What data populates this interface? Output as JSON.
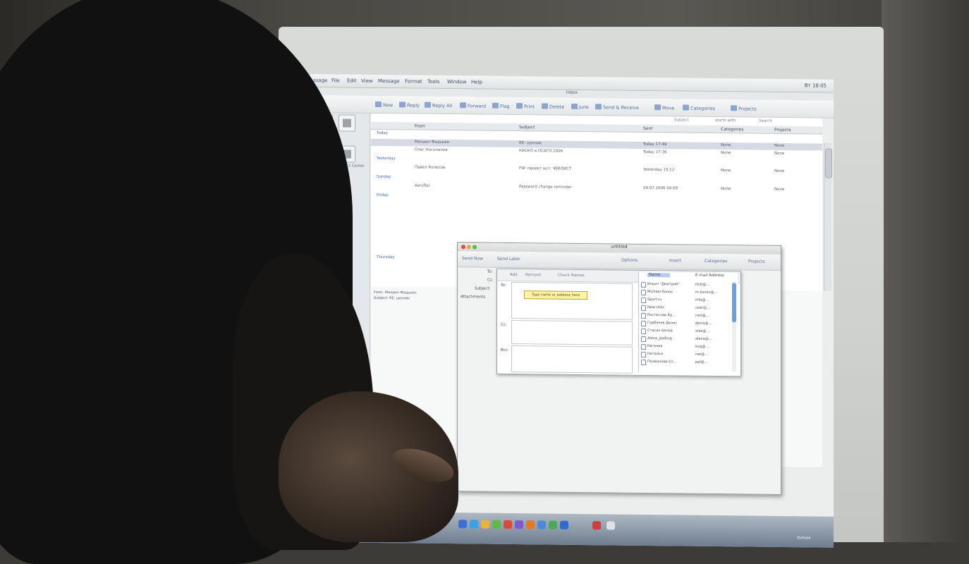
{
  "menubar": {
    "items": [
      "ssage",
      "File",
      "Edit",
      "View",
      "Message",
      "Format",
      "Tools",
      "Window",
      "Help"
    ],
    "clock": "Вт 18:05"
  },
  "window_title": "Inbox",
  "toolbar": {
    "items": [
      "New",
      "Reply",
      "Reply All",
      "Forward",
      "Flag",
      "Print",
      "Delete",
      "Junk",
      "Send & Receive",
      "Move",
      "Categories",
      "Projects"
    ]
  },
  "sidebar": {
    "labels": [
      "Project Center"
    ]
  },
  "list": {
    "columns": [
      "From",
      "Subject",
      "Sent",
      "Categories",
      "Projects"
    ],
    "filter": [
      "Subject",
      "starts with",
      "Search"
    ],
    "groups": {
      "today": "Today",
      "yesterday": "Yesterday",
      "sunday": "Sunday",
      "friday": "Friday",
      "thursday": "Thursday"
    },
    "rows": [
      {
        "from": "Михаил Федькин",
        "subject": "RE: ценник",
        "sent": "Today 17:48",
        "cat": "None",
        "proj": "None"
      },
      {
        "from": "Олег Косолапов",
        "subject": "КАСКО и ОСАГО 2006",
        "sent": "Today 17:36",
        "cat": "None",
        "proj": "None"
      },
      {
        "from": "Павел Колесов",
        "subject": "FW: проект вот: ЧЕКЛИСТ",
        "sent": "Yesterday 15:12",
        "cat": "None",
        "proj": "None"
      },
      {
        "from": "Aeroflot",
        "subject": "Password change reminder",
        "sent": "09.07.2006 04:09",
        "cat": "None",
        "proj": "None"
      }
    ]
  },
  "preview": {
    "lines": [
      "From: Михаил Федькин",
      "Subject: RE: ценник"
    ]
  },
  "compose": {
    "title": "untitled",
    "toolbar": [
      "Send Now",
      "Send Later",
      "Options",
      "Insert",
      "Categories",
      "Projects"
    ],
    "fields": [
      "To:",
      "Cc:",
      "Subject:",
      "Attachments"
    ],
    "picker": {
      "tools": [
        "Add",
        "Remove",
        "Check Names"
      ],
      "to_label": "To:",
      "cc_label": "Cc:",
      "bcc_label": "Bcc:",
      "tooltip": "Type name or address here"
    },
    "contacts": {
      "header_name": "Name",
      "header_email": "E-mail Address",
      "rows": [
        {
          "name": "Ильич \"Дмитрий\"",
          "email": "ilich@..."
        },
        {
          "name": "Michael Konov",
          "email": "m.konov@..."
        },
        {
          "name": "Sport.ru",
          "email": "info@..."
        },
        {
          "name": "New User",
          "email": "user@..."
        },
        {
          "name": "Ростислав Кр...",
          "email": "rost@..."
        },
        {
          "name": "Горбачев Денис",
          "email": "denis@..."
        },
        {
          "name": "Стасик Белов",
          "email": "stas@..."
        },
        {
          "name": "Alena_padivig",
          "email": "alena@..."
        },
        {
          "name": "Евгения",
          "email": "evg@..."
        },
        {
          "name": "Наталья",
          "email": "nat@..."
        },
        {
          "name": "Полеонова Ел...",
          "email": "pol@..."
        }
      ]
    }
  },
  "taskbar": {
    "status": "Outlook"
  }
}
